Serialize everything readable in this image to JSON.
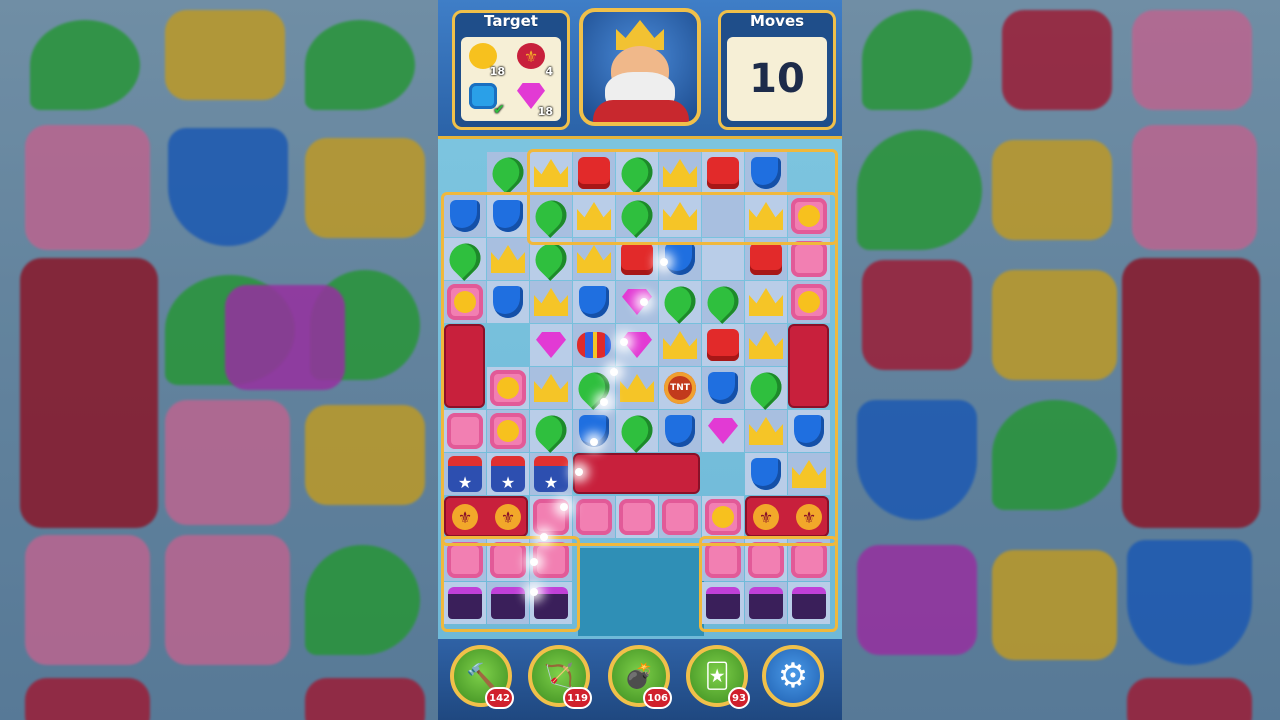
{
  "hud": {
    "target_title": "Target",
    "moves_title": "Moves",
    "moves_left": "10",
    "targets": [
      {
        "icon": "duck-icon",
        "count": "18"
      },
      {
        "icon": "fleur-de-lis-icon",
        "count": "4"
      },
      {
        "icon": "blue-tile-icon",
        "count": "",
        "completed": true
      },
      {
        "icon": "pink-gem-icon",
        "count": "18"
      }
    ]
  },
  "board": {
    "tnt_label": "TNT"
  },
  "boosters": [
    {
      "name": "hammer",
      "count": "142"
    },
    {
      "name": "arrow",
      "count": "119"
    },
    {
      "name": "cannon",
      "count": "106"
    },
    {
      "name": "jester-hat",
      "count": "93"
    }
  ],
  "colors": {
    "accent": "#f0c04a",
    "hud_blue": "#2b63a8",
    "badge_red": "#d0202c"
  }
}
